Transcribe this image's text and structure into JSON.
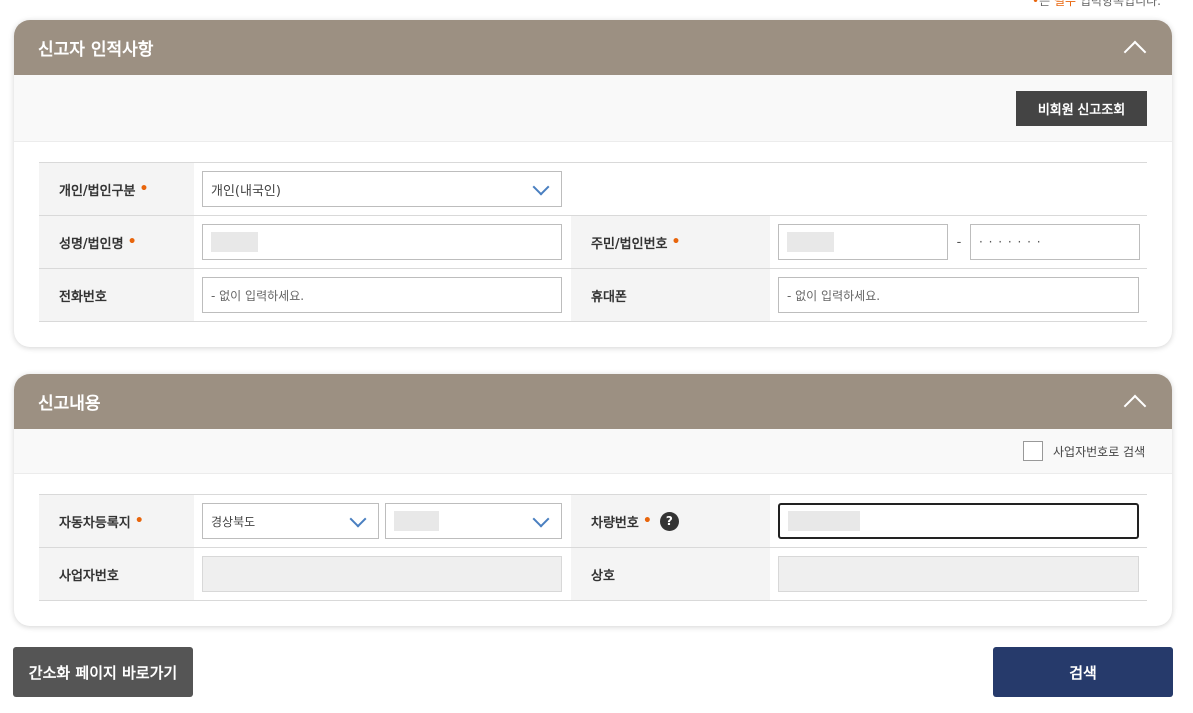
{
  "top_note": {
    "dot": "•",
    "prefix": "는 ",
    "required": "필수",
    "suffix": " 입력항목입니다."
  },
  "section1": {
    "title": "신고자 인적사항",
    "lookup_button": "비회원 신고조회",
    "rows": {
      "type_label": "개인/법인구분",
      "type_value": "개인(내국인)",
      "name_label": "성명/법인명",
      "id_label": "주민/법인번호",
      "id_separator": "-",
      "id_back_masked": "· · · · · · ·",
      "phone_label": "전화번호",
      "phone_placeholder": "- 없이 입력하세요.",
      "mobile_label": "휴대폰",
      "mobile_placeholder": "- 없이 입력하세요."
    }
  },
  "section2": {
    "title": "신고내용",
    "checkbox_label": "사업자번호로 검색",
    "rows": {
      "region_label": "자동차등록지",
      "region_value": "경상북도",
      "plate_label": "차량번호",
      "help_icon": "?",
      "biz_no_label": "사업자번호",
      "company_label": "상호"
    }
  },
  "required_mark": "•",
  "buttons": {
    "simple_page": "간소화 페이지 바로가기",
    "search": "검색"
  },
  "colors": {
    "header": "#9c9082",
    "primary": "#263a6b",
    "dark_button": "#444444",
    "required": "#e8650c"
  }
}
